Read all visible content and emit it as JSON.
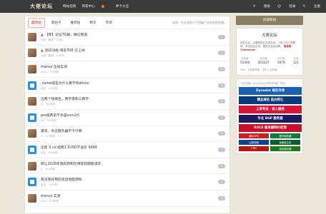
{
  "brand": {
    "logo": "大佬论坛"
  },
  "nav": [
    "网站指南",
    "周家中心",
    "神卡大全"
  ],
  "top_right": {
    "search": "搜索",
    "login": "登录",
    "register": "注册"
  },
  "tabs": [
    "最新帖",
    "新帖子",
    "推荐帖",
    "精华",
    "市场"
  ],
  "notice": "站务：在无关帖子下回复广告社区的处理。",
  "posts": [
    {
      "title": "【荐】论坛TG群，微信频道",
      "meta": "大佬 · 置顶 · 2天前",
      "count": "0",
      "pinned": true
    },
    {
      "title": "测试功能:域名市场 已上线",
      "meta": "大佬 · 置顶 · 24天前",
      "count": "1",
      "pinned": true
    },
    {
      "title": "manus 全局实测",
      "meta": "chuy · 3小时前",
      "count": "14",
      "pinned": false
    },
    {
      "title": ".name域名为什么要不到whois",
      "meta": "域名 · 3小时前",
      "count": "10",
      "pinned": false
    },
    {
      "title": "出两个短域名，两字母和三数字",
      "meta": "出 · 3小时前",
      "count": "2",
      "pinned": false
    },
    {
      "title": "pro续费前不多是com2价",
      "meta": "xin · 5小时前",
      "count": "4",
      "pinned": false
    },
    {
      "title": "美哥，你这服务器不卡行啊",
      "meta": "小 · 5小时前",
      "count": "5",
      "pinned": false
    },
    {
      "title": "出售 X.cd 续费1.5USD不溢价 9999",
      "meta": "域名 · 6小时前",
      "count": "7",
      "pinned": false
    },
    {
      "title": "转让2026年我的周和社博客较期建谋求",
      "meta": "小 · 6小时前",
      "count": "3",
      "pinned": false
    },
    {
      "title": "有没有好用的足迹地图源码",
      "meta": "足迹 · 7小时前",
      "count": "2",
      "pinned": false
    },
    {
      "title": "manus 实测",
      "meta": "chuy · 8小时前",
      "count": "1",
      "pinned": false
    }
  ],
  "sidebar": {
    "create_label": "创建新帖",
    "card_title": "大佬论坛",
    "desc": "站长论坛，主要网站长交流交流，十年工作人员群体，专注站长交流，提供交流活动等。",
    "contact": "电报群：@daleonet",
    "stats": [
      {
        "label": "总帖数",
        "value": "53440"
      },
      {
        "label": "帖子数",
        "value": "403237"
      },
      {
        "label": "用户数",
        "value": "5979"
      },
      {
        "label": "在线",
        "value": "121"
      }
    ],
    "tips": "Tips：交易需谨慎，谨防上当受骗！",
    "ad_head": "广告位招租（可以在此处放置你的推广内容）",
    "banners": [
      {
        "text": "Dynadot 域名市场",
        "color": "#1a5fb4"
      },
      {
        "text": "精品域名 低价转让",
        "color": "#0a3b7a"
      },
      {
        "text": "上岸专业 · 投入服务",
        "color": "#d4143a"
      },
      {
        "text": "华北 BGP 服务器",
        "color": "#1b1b5e"
      },
      {
        "text": "ROCE 服务器特价促销",
        "color": "#c8102e"
      }
    ],
    "small_ads": [
      {
        "text": "廉价VPS",
        "color": "#cc1f1f"
      },
      {
        "text": "国外服务器",
        "color": "#0f7a3c"
      },
      {
        "text": "云服务器",
        "color": "#16408a"
      },
      {
        "text": "免备案主机",
        "color": "#0d5e2f"
      },
      {
        "text": "CDN",
        "color": "#b81414"
      },
      {
        "text": "高防服务器",
        "color": "#1a7a1a"
      }
    ]
  },
  "colors": {
    "topbar": "#3a3a3a",
    "accent": "#c0392b",
    "button": "#8a7d63",
    "background": "#ece8dc"
  }
}
